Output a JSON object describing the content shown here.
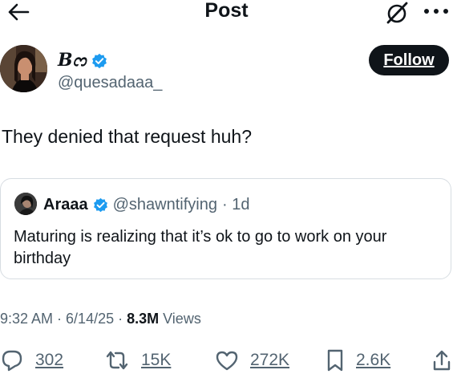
{
  "header": {
    "title": "Post"
  },
  "author": {
    "display_name": "Bᦂ",
    "handle": "@quesadaaa_",
    "verified": true,
    "follow_label": "Follow"
  },
  "post": {
    "text": "They denied that request huh?"
  },
  "quote": {
    "display_name": "Araaa",
    "handle": "@shawntifying",
    "time": "· 1d",
    "text": "Maturing is realizing that it’s ok to go to work on your birthday"
  },
  "meta": {
    "time": "9:32 AM",
    "date": "· 6/14/25 ·",
    "views_count": "8.3M",
    "views_label": "Views"
  },
  "actions": {
    "replies": "302",
    "reposts": "15K",
    "likes": "272K",
    "bookmarks": "2.6K"
  },
  "colors": {
    "text": "#0f1419",
    "secondary": "#536471",
    "verified": "#1d9bf0",
    "border": "#d7dde2"
  }
}
